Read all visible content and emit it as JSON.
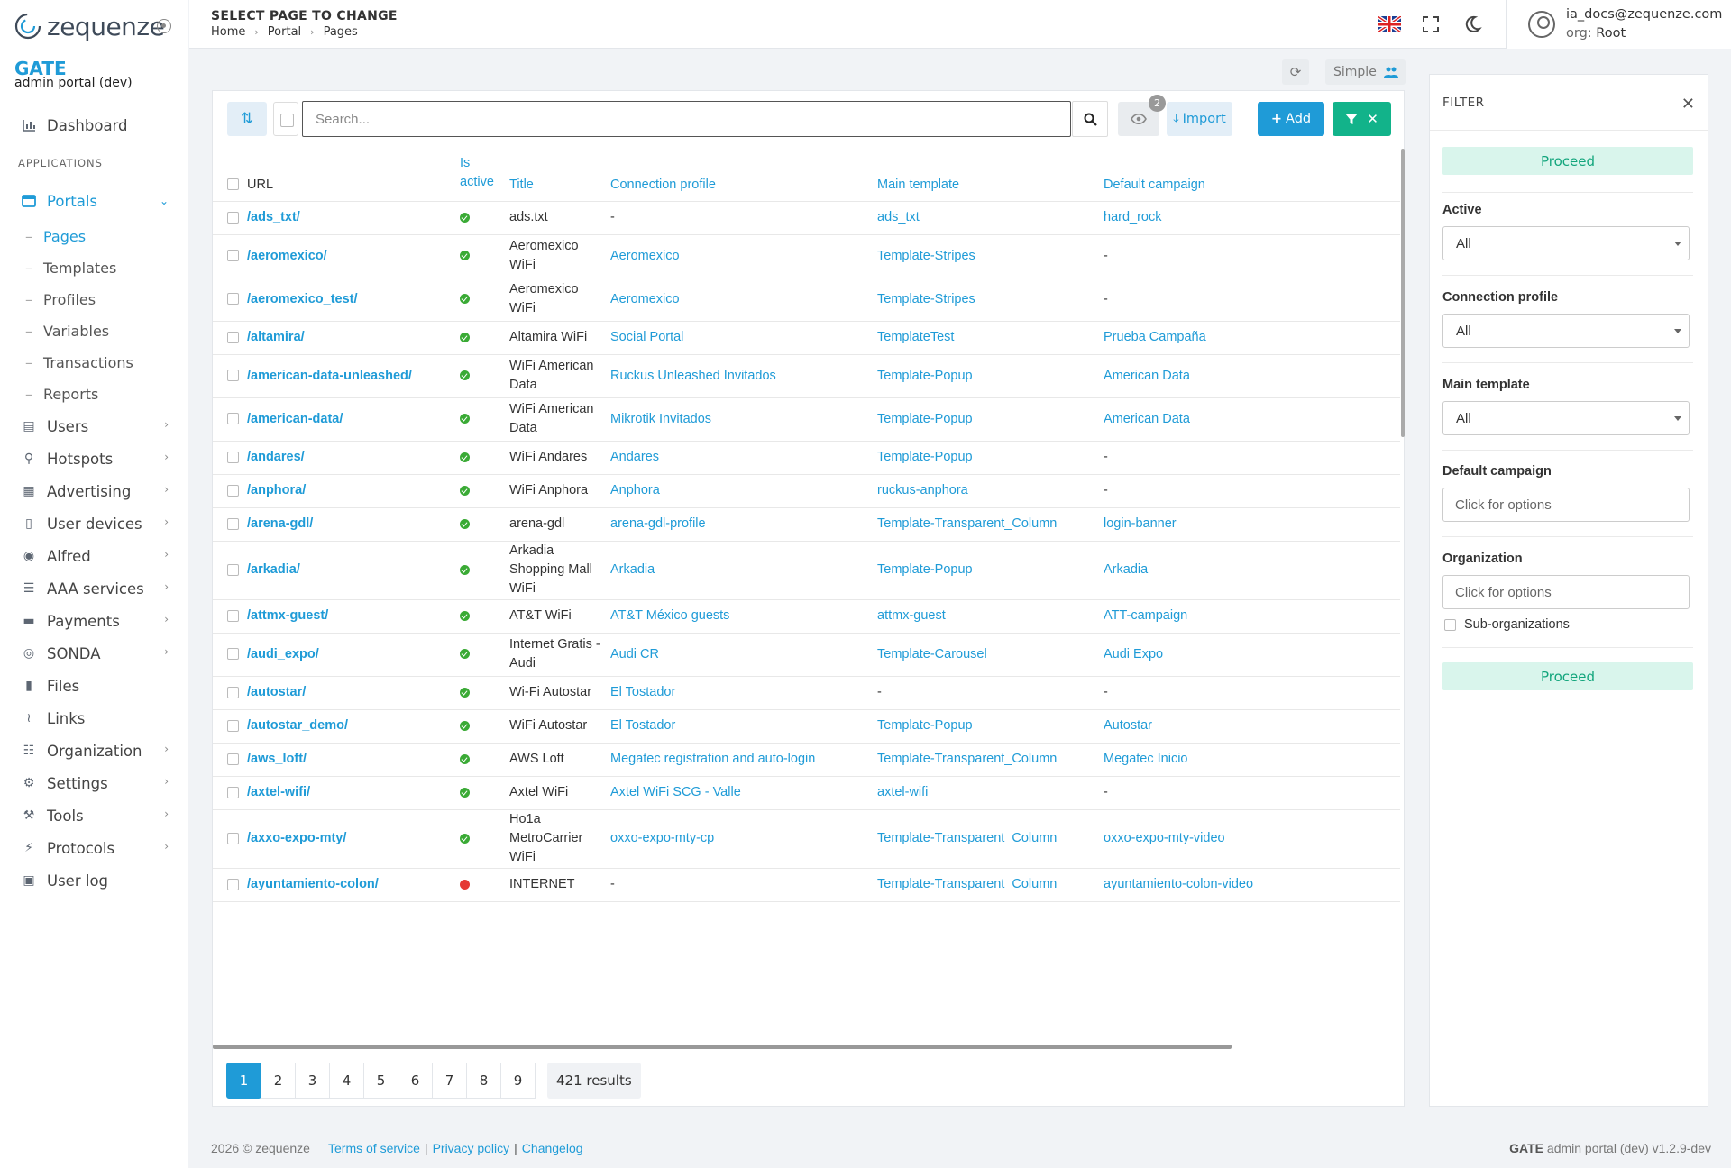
{
  "brand": {
    "logo_text": "zequenze",
    "title": "GATE",
    "subtitle": "admin portal (dev)"
  },
  "sidebar": {
    "dashboard": "Dashboard",
    "section_label": "APPLICATIONS",
    "portals": "Portals",
    "portal_children": [
      "Pages",
      "Templates",
      "Profiles",
      "Variables",
      "Transactions",
      "Reports"
    ],
    "items": [
      {
        "label": "Users",
        "icon": "id-card-icon",
        "chev": true
      },
      {
        "label": "Hotspots",
        "icon": "map-pin-icon",
        "chev": true
      },
      {
        "label": "Advertising",
        "icon": "newspaper-icon",
        "chev": true
      },
      {
        "label": "User devices",
        "icon": "mobile-icon",
        "chev": true
      },
      {
        "label": "Alfred",
        "icon": "robot-icon",
        "chev": true
      },
      {
        "label": "AAA services",
        "icon": "database-icon",
        "chev": true
      },
      {
        "label": "Payments",
        "icon": "credit-card-icon",
        "chev": true
      },
      {
        "label": "SONDA",
        "icon": "globe-icon",
        "chev": true
      },
      {
        "label": "Files",
        "icon": "folder-icon",
        "chev": false
      },
      {
        "label": "Links",
        "icon": "share-icon",
        "chev": false
      },
      {
        "label": "Organization",
        "icon": "sitemap-icon",
        "chev": true
      },
      {
        "label": "Settings",
        "icon": "cogs-icon",
        "chev": true
      },
      {
        "label": "Tools",
        "icon": "tools-icon",
        "chev": true
      },
      {
        "label": "Protocols",
        "icon": "plug-icon",
        "chev": true
      },
      {
        "label": "User log",
        "icon": "calendar-icon",
        "chev": false
      }
    ]
  },
  "header": {
    "title": "SELECT PAGE TO CHANGE",
    "breadcrumb": [
      "Home",
      "Portal",
      "Pages"
    ],
    "user_email": "ia_docs@zequenze.com",
    "org_label": "org:",
    "org_value": "Root"
  },
  "view_toggle": {
    "label": "Simple"
  },
  "toolbar": {
    "search_placeholder": "Search...",
    "hidden_columns_badge": "2",
    "import_label": "Import",
    "add_label": "Add"
  },
  "table": {
    "columns": {
      "url": "URL",
      "is_active_1": "Is",
      "is_active_2": "active",
      "title": "Title",
      "connection_profile": "Connection profile",
      "main_template": "Main template",
      "default_campaign": "Default campaign"
    },
    "rows": [
      {
        "url": "/ads_txt/",
        "active": true,
        "title": "ads.txt",
        "profile": "-",
        "template": "ads_txt",
        "campaign": "hard_rock"
      },
      {
        "url": "/aeromexico/",
        "active": true,
        "title": "Aeromexico WiFi",
        "profile": "Aeromexico",
        "template": "Template-Stripes",
        "campaign": "-"
      },
      {
        "url": "/aeromexico_test/",
        "active": true,
        "title": "Aeromexico WiFi",
        "profile": "Aeromexico",
        "template": "Template-Stripes",
        "campaign": "-"
      },
      {
        "url": "/altamira/",
        "active": true,
        "title": "Altamira WiFi",
        "profile": "Social Portal",
        "template": "TemplateTest",
        "campaign": "Prueba Campaña"
      },
      {
        "url": "/american-data-unleashed/",
        "active": true,
        "title": "WiFi American Data",
        "profile": "Ruckus Unleashed Invitados",
        "template": "Template-Popup",
        "campaign": "American Data"
      },
      {
        "url": "/american-data/",
        "active": true,
        "title": "WiFi American Data",
        "profile": "Mikrotik Invitados",
        "template": "Template-Popup",
        "campaign": "American Data"
      },
      {
        "url": "/andares/",
        "active": true,
        "title": "WiFi Andares",
        "profile": "Andares",
        "template": "Template-Popup",
        "campaign": "-"
      },
      {
        "url": "/anphora/",
        "active": true,
        "title": "WiFi Anphora",
        "profile": "Anphora",
        "template": "ruckus-anphora",
        "campaign": "-"
      },
      {
        "url": "/arena-gdl/",
        "active": true,
        "title": "arena-gdl",
        "profile": "arena-gdl-profile",
        "template": "Template-Transparent_Column",
        "campaign": "login-banner"
      },
      {
        "url": "/arkadia/",
        "active": true,
        "title": "Arkadia Shopping Mall WiFi",
        "profile": "Arkadia",
        "template": "Template-Popup",
        "campaign": "Arkadia"
      },
      {
        "url": "/attmx-guest/",
        "active": true,
        "title": "AT&T WiFi",
        "profile": "AT&T México guests",
        "template": "attmx-guest",
        "campaign": "ATT-campaign"
      },
      {
        "url": "/audi_expo/",
        "active": true,
        "title": "Internet Gratis - Audi",
        "profile": "Audi CR",
        "template": "Template-Carousel",
        "campaign": "Audi Expo"
      },
      {
        "url": "/autostar/",
        "active": true,
        "title": "Wi-Fi Autostar",
        "profile": "El Tostador",
        "template": "-",
        "campaign": "-"
      },
      {
        "url": "/autostar_demo/",
        "active": true,
        "title": "WiFi Autostar",
        "profile": "El Tostador",
        "template": "Template-Popup",
        "campaign": "Autostar"
      },
      {
        "url": "/aws_loft/",
        "active": true,
        "title": "AWS Loft",
        "profile": "Megatec registration and auto-login",
        "template": "Template-Transparent_Column",
        "campaign": "Megatec Inicio"
      },
      {
        "url": "/axtel-wifi/",
        "active": true,
        "title": "Axtel WiFi",
        "profile": "Axtel WiFi SCG - Valle",
        "template": "axtel-wifi",
        "campaign": "-"
      },
      {
        "url": "/axxo-expo-mty/",
        "active": true,
        "title": "Ho1a MetroCarrier WiFi",
        "profile": "oxxo-expo-mty-cp",
        "template": "Template-Transparent_Column",
        "campaign": "oxxo-expo-mty-video"
      },
      {
        "url": "/ayuntamiento-colon/",
        "active": false,
        "title": "INTERNET",
        "profile": "-",
        "template": "Template-Transparent_Column",
        "campaign": "ayuntamiento-colon-video"
      }
    ]
  },
  "pagination": {
    "pages": [
      "1",
      "2",
      "3",
      "4",
      "5",
      "6",
      "7",
      "8",
      "9"
    ],
    "current": "1",
    "results": "421 results"
  },
  "filter": {
    "title": "FILTER",
    "proceed": "Proceed",
    "active_label": "Active",
    "active_value": "All",
    "connection_profile_label": "Connection profile",
    "connection_profile_value": "All",
    "main_template_label": "Main template",
    "main_template_value": "All",
    "default_campaign_label": "Default campaign",
    "default_campaign_placeholder": "Click for options",
    "organization_label": "Organization",
    "organization_placeholder": "Click for options",
    "sub_org_label": "Sub-organizations"
  },
  "footer": {
    "copyright": "2026 © zequenze",
    "links": [
      "Terms of service",
      "Privacy policy",
      "Changelog"
    ],
    "version_brand": "GATE",
    "version_text": "admin portal (dev) v1.2.9-dev"
  },
  "colors": {
    "accent": "#1f9bd7",
    "filter_green": "#12b38a",
    "active_green": "#3aaa35",
    "inactive_red": "#e53935"
  }
}
